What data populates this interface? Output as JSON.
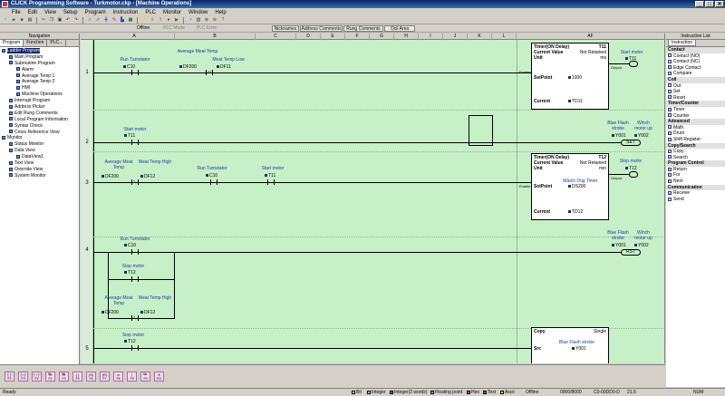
{
  "window": {
    "title": "CLICK Programming Software - Turkmotor.ckp - [Machine Operations]",
    "controls": [
      "_",
      "□",
      "✕"
    ]
  },
  "menu": [
    "File",
    "Edit",
    "View",
    "Setup",
    "Program",
    "Instruction",
    "PLC",
    "Monitor",
    "Window",
    "Help"
  ],
  "modebar": {
    "offline": "Offline",
    "plc_mode": "PLC Mode",
    "plc_error": "PLC Error",
    "view_tabs": [
      "Nicknames",
      "Address Comments",
      "Rung Comments",
      "Ocil Area"
    ]
  },
  "navigation": {
    "title": "Navigation",
    "tabs": [
      "Program",
      "Function",
      "PLC..."
    ],
    "tree": [
      "Ladder Program",
      "Main Program",
      "Subroutine Program",
      "Alarm",
      "Average Temp 1",
      "Average Temp 2",
      "HMI",
      "Machine Operations",
      "Interrupt Program",
      "Address Picker",
      "Edit Rung Comments",
      "Local Program Information",
      "Syntax Check",
      "Cross Reference View",
      "Monitor",
      "Status Monitor",
      "Data View",
      "DataView1",
      "Text View",
      "Override View",
      "System Monitor"
    ]
  },
  "ladder": {
    "columns": [
      "A",
      "B",
      "C",
      "D",
      "E",
      "F",
      "G",
      "H",
      "I",
      "J",
      "K",
      "L",
      "AF"
    ],
    "rung_numbers": [
      "1",
      "2",
      "3",
      "4",
      "5"
    ],
    "rung1": {
      "c1_label": "Run Turnstator",
      "c1_addr": "C10",
      "c2_label": "Average Meat Temp",
      "c2_addr": "DF200",
      "c3_label": "Meat Temp Low",
      "c3_addr": "DF11",
      "c2_op": ">=",
      "coil_label": "Start motor",
      "coil_addr": "T11",
      "timer": {
        "title": "Timer(ON Delay)",
        "id": "T11",
        "current_value": "Current Value",
        "not_retained": "Not Retained",
        "unit": "Unit",
        "unit_val": "ms",
        "setpoint": "SetPoint",
        "sp_val": "1000",
        "current": "Current",
        "cur_val": "TD11",
        "enable": "Enable",
        "output": "Output"
      }
    },
    "rung2": {
      "c1_label": "Start motor",
      "c1_addr": "T11",
      "coil1_label": "Blue Flash strobe",
      "coil1_addr": "Y001",
      "coil2_label": "Winch motor up",
      "coil2_addr": "Y002",
      "coil_text": "SET"
    },
    "rung3": {
      "c1_label": "Average Meat Temp",
      "c1_addr": "DF200",
      "c2_label": "Meat Temp High",
      "c2_addr": "DF12",
      "c3_label": "Run Turnstator",
      "c3_addr": "C10",
      "c4_label": "Start motor",
      "c4_addr": "T11",
      "op": "<",
      "coil_label": "Stop motor",
      "coil_addr": "T12",
      "timer": {
        "title": "Timer(ON Delay)",
        "id": "T12",
        "current_value": "Current Value",
        "not_retained": "Not Retained",
        "unit": "Unit",
        "unit_val": "min",
        "setpoint": "SetPoint",
        "sp_label": "Watch Dog Timer",
        "sp_val": "DS200",
        "current": "Current",
        "cur_val": "TD12",
        "enable": "Enable",
        "output": "Output"
      }
    },
    "rung4": {
      "c1_label": "Run Turnstator",
      "c1_addr": "C10",
      "c2_label": "Stop motor",
      "c2_addr": "T12",
      "c3_label": "Average Meat Temp",
      "c3_addr": "DF200",
      "c4_label": "Meat Temp High",
      "c4_addr": "DF12",
      "op": ">",
      "coil1_label": "Blue Flash strobe",
      "coil1_addr": "Y001",
      "coil2_label": "Winch motor up",
      "coil2_addr": "Y002",
      "coil_text": "RST"
    },
    "rung5": {
      "c1_label": "Stop motor",
      "c1_addr": "T12",
      "copy": {
        "title": "Copy",
        "mode": "Single",
        "src": "Src",
        "src_label": "Blue Flash strobe",
        "src_addr": "Y001"
      }
    }
  },
  "instruction_list": {
    "title": "Instruction List",
    "tab": "Instruction",
    "groups": [
      {
        "name": "Contact",
        "items": [
          "Contact (NO)",
          "Contact (NC)",
          "Edge Contact",
          "Compare"
        ]
      },
      {
        "name": "Coil",
        "items": [
          "Out",
          "Set",
          "Reset"
        ]
      },
      {
        "name": "Timer/Counter",
        "items": [
          "Timer",
          "Counter"
        ]
      },
      {
        "name": "Advanced",
        "items": [
          "Math",
          "Drum",
          "Shift Register"
        ]
      },
      {
        "name": "Copy/Search",
        "items": [
          "Copy",
          "Search"
        ]
      },
      {
        "name": "Program Control",
        "items": [
          "Return",
          "For",
          "Next"
        ]
      },
      {
        "name": "Communication",
        "items": [
          "Receive",
          "Send"
        ]
      }
    ]
  },
  "fkeys": [
    "F2",
    "F3",
    "F4",
    "Sh-F2",
    "Sh-F3",
    "F5",
    "F6",
    "F7",
    "F8",
    "F9",
    "Sh-F9",
    "F11"
  ],
  "status": {
    "ready": "Ready",
    "legend": [
      {
        "label": "Bit",
        "color": "#e0e0e0"
      },
      {
        "label": "Integer",
        "color": "#a0c8f0"
      },
      {
        "label": "Integer(2 words)",
        "color": "#4080c0"
      },
      {
        "label": "Floating point",
        "color": "#f0a040"
      },
      {
        "label": "Hex",
        "color": "#c040c0"
      },
      {
        "label": "Text",
        "color": "#40a040"
      },
      {
        "label": "Ascii",
        "color": "#e0e040"
      }
    ],
    "mode": "Offline",
    "count": "0000/8000",
    "addr": "C0-00DD0-D",
    "zoom": "21.6",
    "num": "NUM"
  }
}
